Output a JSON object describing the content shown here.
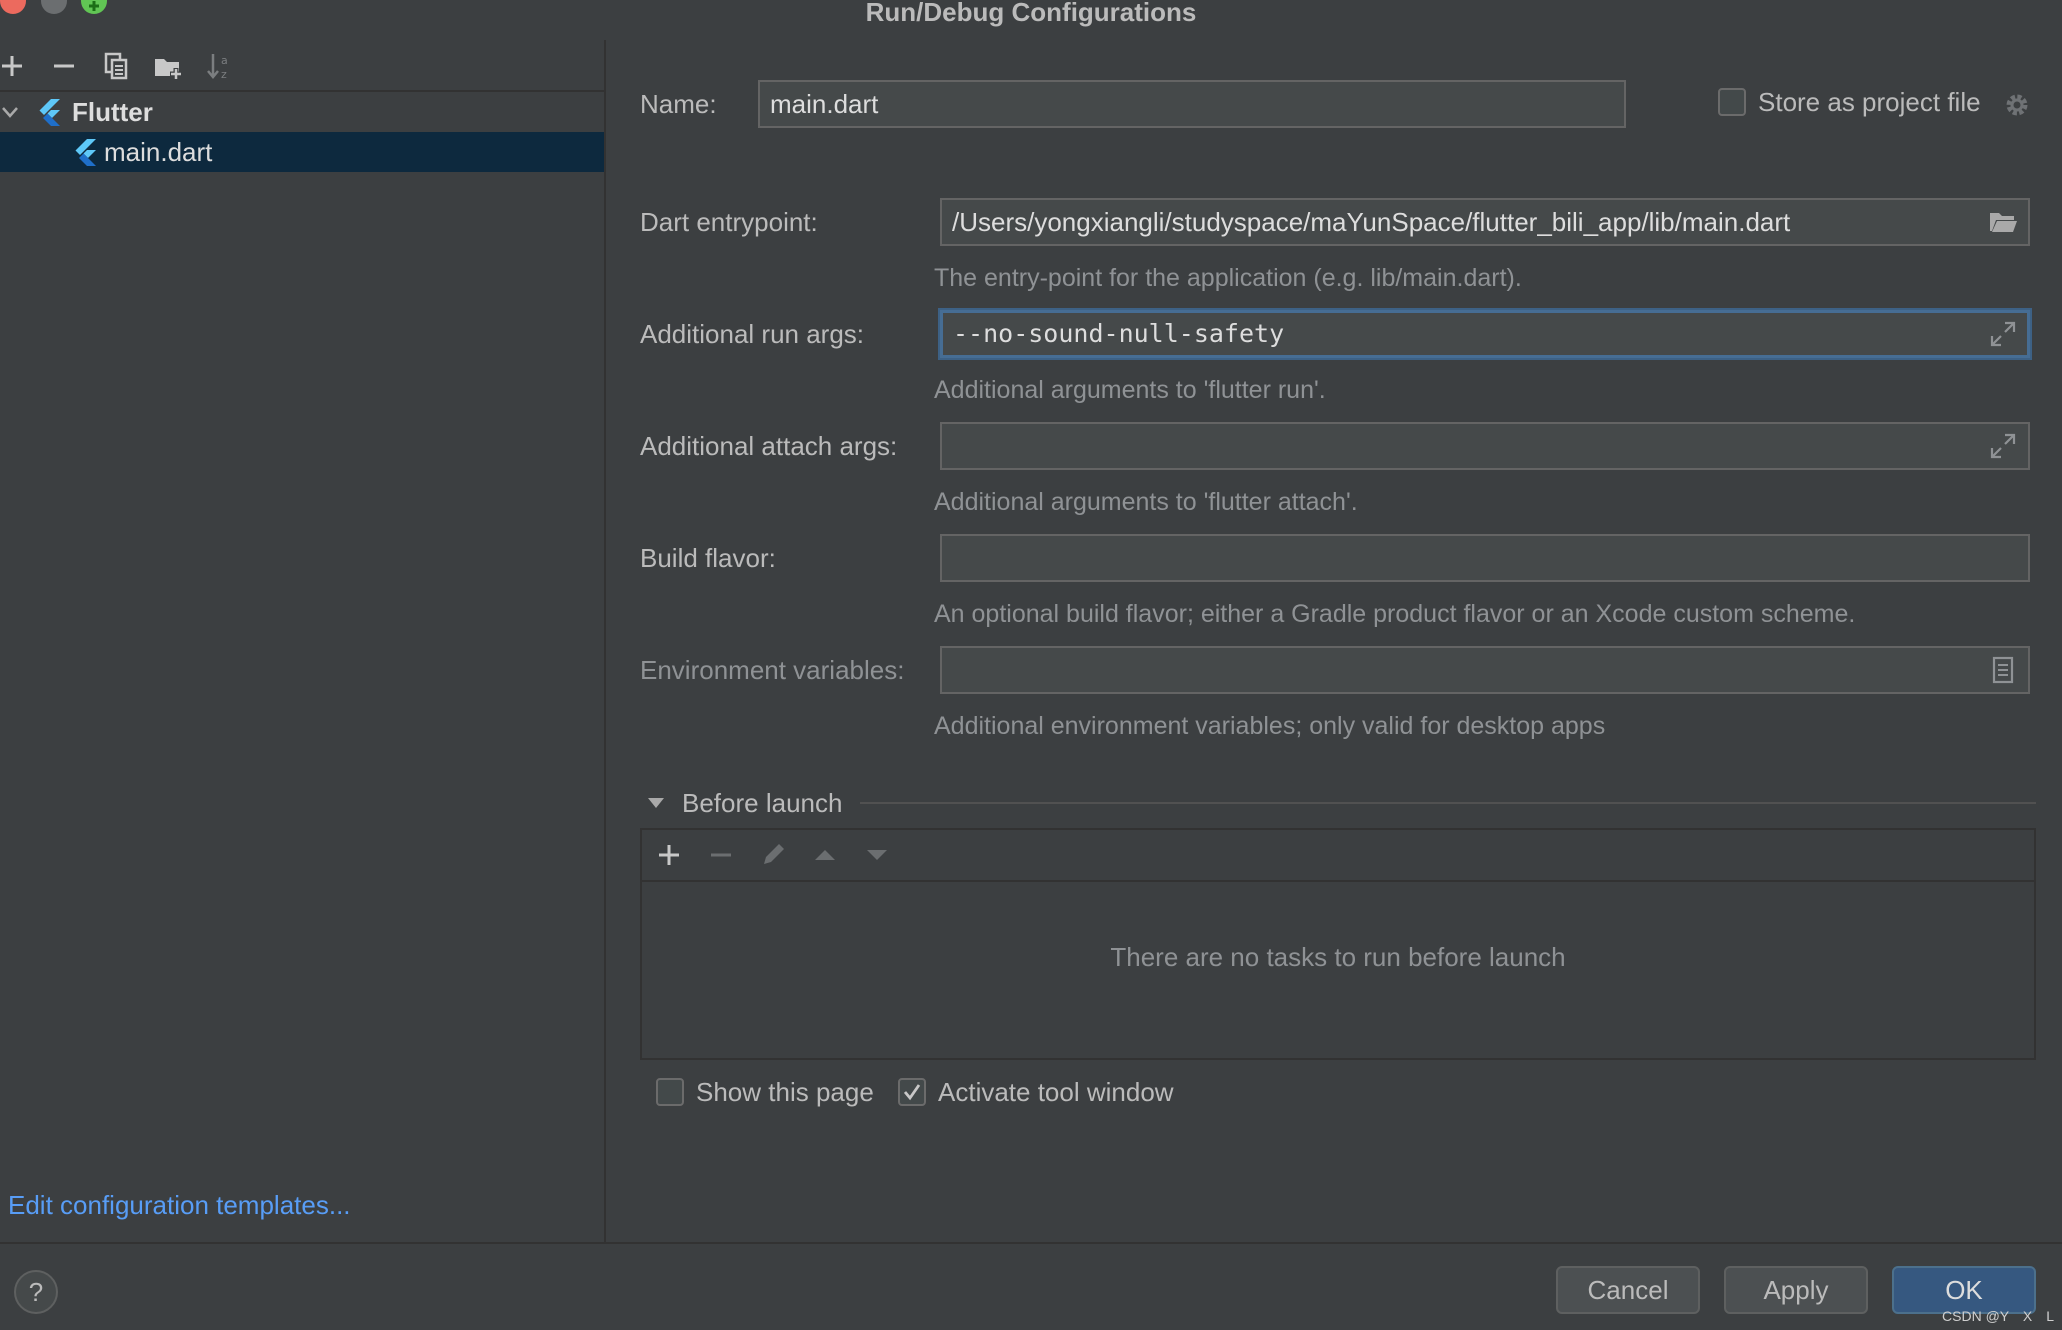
{
  "window": {
    "title": "Run/Debug Configurations",
    "controls": [
      "close",
      "minimize",
      "zoom"
    ]
  },
  "sidebar": {
    "toolbar_icons": [
      "plus-icon",
      "minus-icon",
      "copy-icon",
      "folder-add-icon",
      "sort-icon"
    ],
    "tree": {
      "group_label": "Flutter",
      "items": [
        {
          "label": "main.dart",
          "selected": true
        }
      ]
    },
    "edit_templates_link": "Edit configuration templates..."
  },
  "form": {
    "name_label": "Name:",
    "name_value": "main.dart",
    "store_label": "Store as project file",
    "store_checked": false,
    "dart_entrypoint": {
      "label": "Dart entrypoint:",
      "value": "/Users/yongxiangli/studyspace/maYunSpace/flutter_bili_app/lib/main.dart",
      "hint": "The entry-point for the application (e.g. lib/main.dart)."
    },
    "run_args": {
      "label": "Additional run args:",
      "value": "--no-sound-null-safety",
      "hint": "Additional arguments to 'flutter run'."
    },
    "attach_args": {
      "label": "Additional attach args:",
      "value": "",
      "hint": "Additional arguments to 'flutter attach'."
    },
    "build_flavor": {
      "label": "Build flavor:",
      "value": "",
      "hint": "An optional build flavor; either a Gradle product flavor or an Xcode custom scheme."
    },
    "env_vars": {
      "label": "Environment variables:",
      "value": "",
      "hint": "Additional environment variables; only valid for desktop apps"
    }
  },
  "before_launch": {
    "title": "Before launch",
    "empty_message": "There are no tasks to run before launch",
    "show_page_label": "Show this page",
    "show_page_checked": false,
    "activate_tool_label": "Activate tool window",
    "activate_tool_checked": true
  },
  "footer": {
    "help_label": "?",
    "cancel": "Cancel",
    "apply": "Apply",
    "ok": "OK",
    "watermark": "CSDN @Y　X　L"
  },
  "colors": {
    "background": "#3c3f41",
    "selection": "#0d293e",
    "link": "#589df6",
    "focus_border": "#466d94",
    "flutter_light": "#5ec8f8",
    "flutter_dark": "#1f6fc9",
    "primary_button": "#365880"
  }
}
